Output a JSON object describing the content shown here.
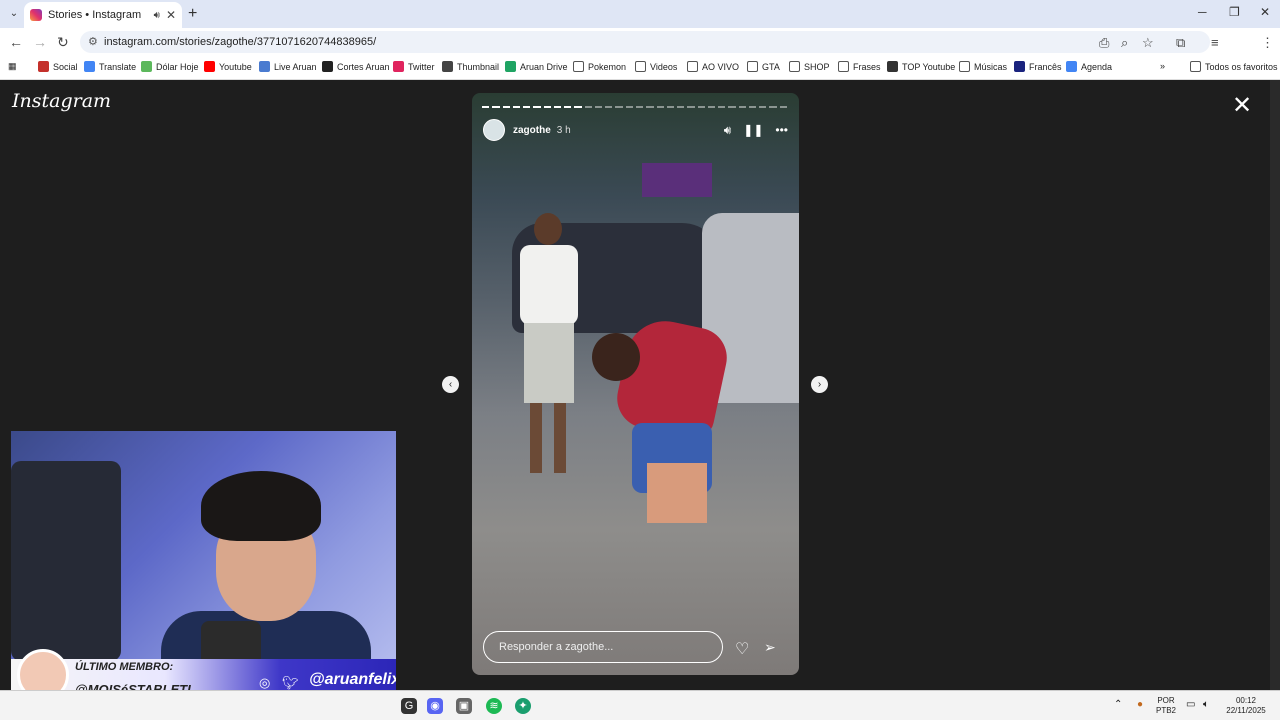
{
  "browser": {
    "tab_title": "Stories • Instagram",
    "new_tab": "+",
    "url": "instagram.com/stories/zagothe/3771071620744838965/",
    "bookmarks": [
      {
        "label": "Social",
        "color": "#c4302b"
      },
      {
        "label": "Translate",
        "color": "#4285f4"
      },
      {
        "label": "Dólar Hoje",
        "color": "#5cb85c"
      },
      {
        "label": "Youtube",
        "color": "#ff0000"
      },
      {
        "label": "Live Aruan",
        "color": "#4a7bd0"
      },
      {
        "label": "Cortes Aruan",
        "color": "#222222"
      },
      {
        "label": "Twitter",
        "color": "#e0245e"
      },
      {
        "label": "Thumbnail",
        "color": "#444444"
      },
      {
        "label": "Aruan Drive",
        "color": "#1fa463"
      },
      {
        "label": "Pokemon",
        "color": "folder"
      },
      {
        "label": "Videos",
        "color": "folder"
      },
      {
        "label": "AO VIVO",
        "color": "folder"
      },
      {
        "label": "GTA",
        "color": "folder"
      },
      {
        "label": "SHOP",
        "color": "folder"
      },
      {
        "label": "Frases",
        "color": "folder"
      },
      {
        "label": "TOP Youtube",
        "color": "#333333"
      },
      {
        "label": "Músicas",
        "color": "folder"
      },
      {
        "label": "Francês",
        "color": "#1a237e"
      },
      {
        "label": "Agenda",
        "color": "#4285f4"
      }
    ],
    "bookmarks_more": "»",
    "all_favorites": "Todos os favoritos"
  },
  "instagram": {
    "logo": "Instagram",
    "story": {
      "username": "zagothe",
      "time": "3 h",
      "reply_placeholder": "Responder a zagothe...",
      "progress_total": 30,
      "progress_done": 10
    }
  },
  "stream_overlay": {
    "member_label": "ÚLTIMO MEMBRO:",
    "member_name": "@MOISéSTABLETI",
    "handle": "@aruanfelix"
  },
  "taskbar": {
    "lang": "POR",
    "layout": "PTB2",
    "time": "00:12",
    "date": "22/11/2025"
  }
}
